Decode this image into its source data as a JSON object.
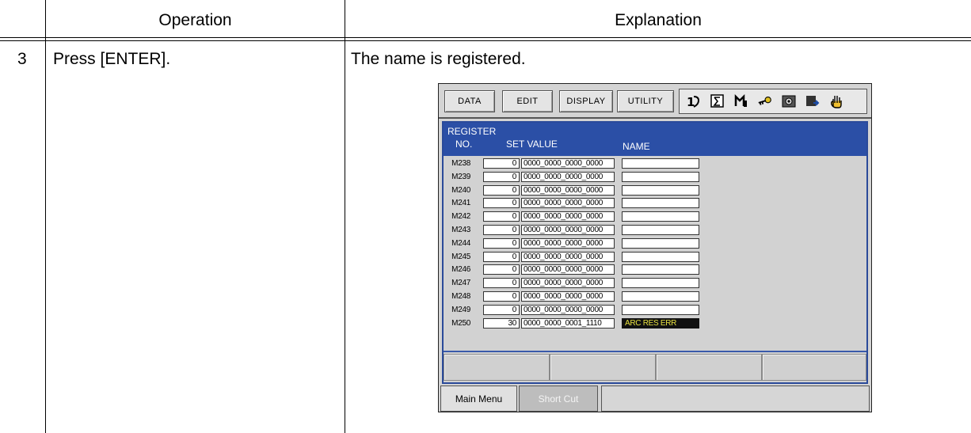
{
  "table": {
    "headers": [
      "",
      "Operation",
      "Explanation"
    ],
    "row": {
      "step": "3",
      "operation": "Press [ENTER].",
      "explanation": "The name is registered."
    }
  },
  "pendant": {
    "menu": [
      "DATA",
      "EDIT",
      "DISPLAY",
      "UTILITY"
    ],
    "icons": [
      "axis-icon",
      "sigma-icon",
      "tool-icon",
      "key-icon",
      "camera-icon",
      "arrow-icon",
      "hand-icon"
    ],
    "screen_title": "REGISTER",
    "col_no": "NO.",
    "col_set": "SET VALUE",
    "col_name": "NAME",
    "registers": [
      {
        "no": "M238",
        "value": "0",
        "bits": "0000_0000_0000_0000",
        "name": ""
      },
      {
        "no": "M239",
        "value": "0",
        "bits": "0000_0000_0000_0000",
        "name": ""
      },
      {
        "no": "M240",
        "value": "0",
        "bits": "0000_0000_0000_0000",
        "name": ""
      },
      {
        "no": "M241",
        "value": "0",
        "bits": "0000_0000_0000_0000",
        "name": ""
      },
      {
        "no": "M242",
        "value": "0",
        "bits": "0000_0000_0000_0000",
        "name": ""
      },
      {
        "no": "M243",
        "value": "0",
        "bits": "0000_0000_0000_0000",
        "name": ""
      },
      {
        "no": "M244",
        "value": "0",
        "bits": "0000_0000_0000_0000",
        "name": ""
      },
      {
        "no": "M245",
        "value": "0",
        "bits": "0000_0000_0000_0000",
        "name": ""
      },
      {
        "no": "M246",
        "value": "0",
        "bits": "0000_0000_0000_0000",
        "name": ""
      },
      {
        "no": "M247",
        "value": "0",
        "bits": "0000_0000_0000_0000",
        "name": ""
      },
      {
        "no": "M248",
        "value": "0",
        "bits": "0000_0000_0000_0000",
        "name": ""
      },
      {
        "no": "M249",
        "value": "0",
        "bits": "0000_0000_0000_0000",
        "name": ""
      },
      {
        "no": "M250",
        "value": "30",
        "bits": "0000_0000_0001_1110",
        "name": "ARC RES ERR"
      }
    ],
    "main_menu": "Main Menu",
    "short_cut": "Short Cut",
    "colors": {
      "header_blue": "#2b4fa6",
      "name_highlight_bg": "#111111",
      "name_highlight_text": "#e6e040"
    }
  }
}
